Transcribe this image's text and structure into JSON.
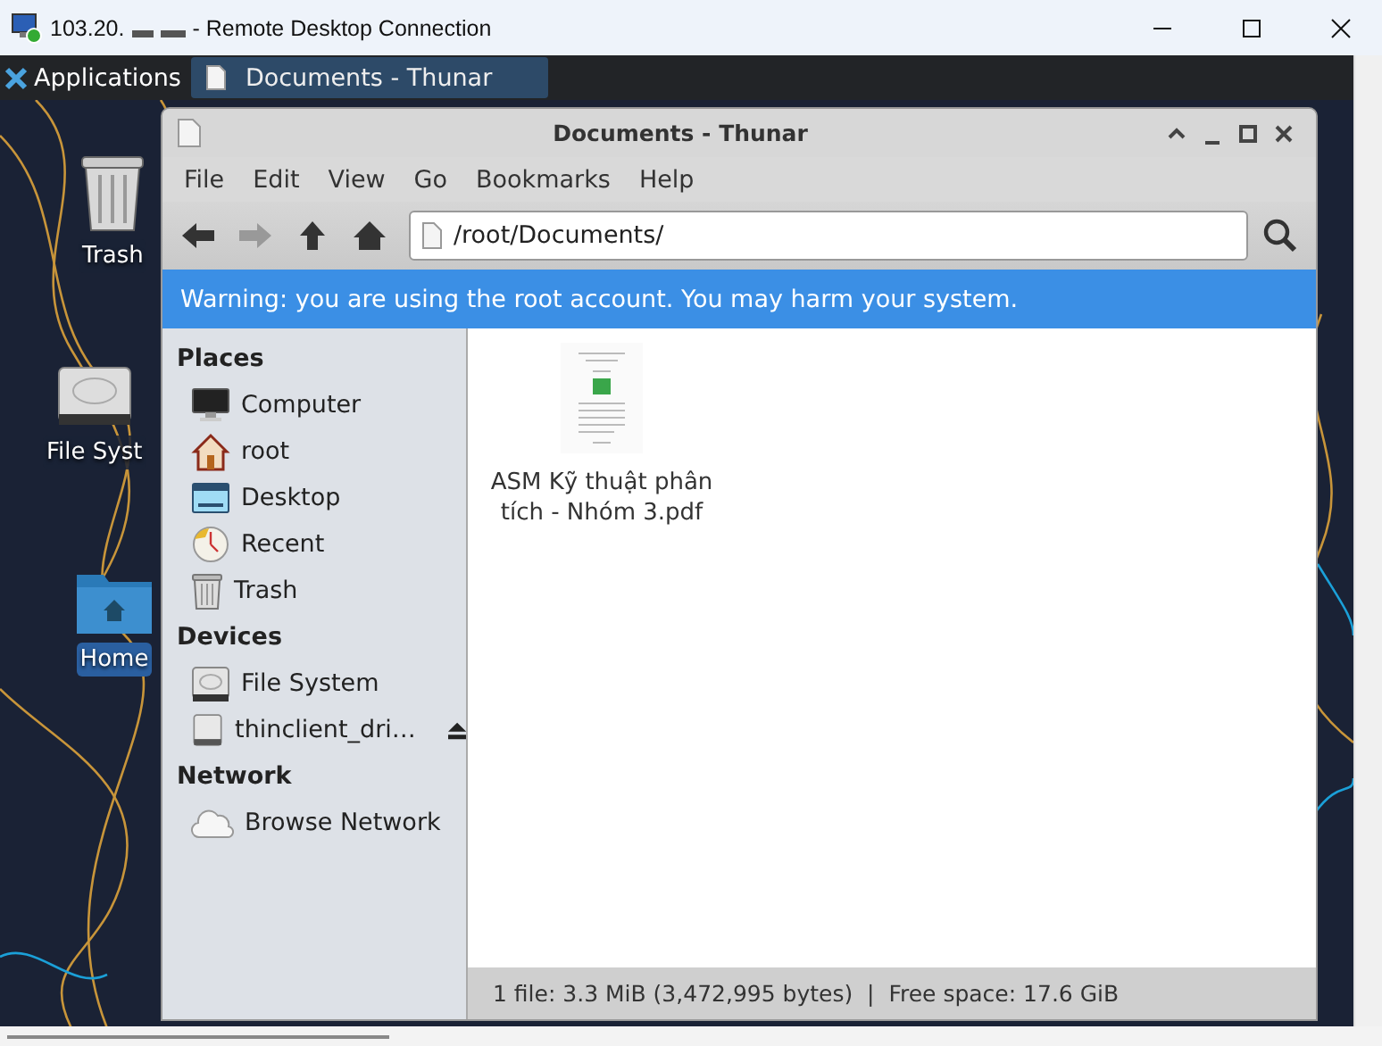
{
  "rdp_window": {
    "title_prefix": "103.20.",
    "title_suffix": "- Remote Desktop Connection"
  },
  "panel": {
    "applications": "Applications",
    "tasks": [
      {
        "label": "Documents - Thunar",
        "selected": true
      }
    ]
  },
  "desktop_icons": [
    {
      "kind": "trash",
      "label": "Trash",
      "selected": false
    },
    {
      "kind": "drive",
      "label": "File Syst",
      "selected": false
    },
    {
      "kind": "home",
      "label": "Home",
      "selected": true
    }
  ],
  "window": {
    "title": "Documents - Thunar",
    "menu": [
      "File",
      "Edit",
      "View",
      "Go",
      "Bookmarks",
      "Help"
    ],
    "location": "/root/Documents/",
    "warning": "Warning: you are using the root account. You may harm your system.",
    "sidebar": [
      {
        "heading": "Places",
        "items": [
          {
            "kind": "computer",
            "label": "Computer"
          },
          {
            "kind": "home",
            "label": "root"
          },
          {
            "kind": "desktop",
            "label": "Desktop"
          },
          {
            "kind": "recent",
            "label": "Recent"
          },
          {
            "kind": "trash",
            "label": "Trash"
          }
        ]
      },
      {
        "heading": "Devices",
        "items": [
          {
            "kind": "drive",
            "label": "File System"
          },
          {
            "kind": "removable",
            "label": "thinclient_dri…"
          }
        ]
      },
      {
        "heading": "Network",
        "items": [
          {
            "kind": "network",
            "label": "Browse Network"
          }
        ]
      }
    ],
    "files": [
      {
        "name": "ASM Kỹ thuật phân tích - Nhóm 3.pdf",
        "selected": false
      }
    ],
    "status_bar": "1 file: 3.3 MiB (3,472,995 bytes)  |  Free space: 17.6 GiB"
  }
}
